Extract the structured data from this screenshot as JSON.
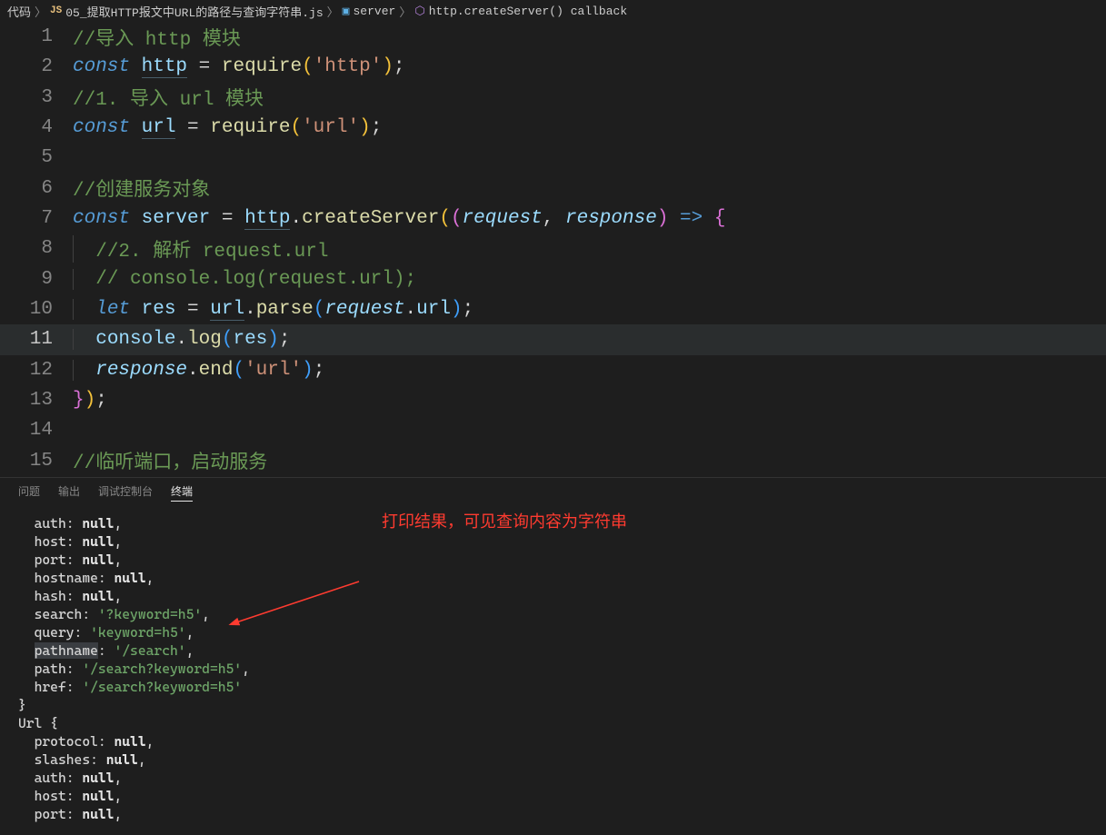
{
  "breadcrumb": {
    "root": "代码",
    "file": "05_提取HTTP报文中URL的路径与查询字符串.js",
    "symbol1": "server",
    "symbol2": "http.createServer() callback"
  },
  "code": {
    "l1_comment": "//导入 http 模块",
    "l2_const": "const",
    "l2_http": "http",
    "l2_eq": " = ",
    "l2_require": "require",
    "l2_lp": "(",
    "l2_str": "'http'",
    "l2_rp": ")",
    "l2_semi": ";",
    "l3_comment": "//1. 导入 url 模块",
    "l4_const": "const",
    "l4_url": "url",
    "l4_eq": " = ",
    "l4_require": "require",
    "l4_lp": "(",
    "l4_str": "'url'",
    "l4_rp": ")",
    "l4_semi": ";",
    "l6_comment": "//创建服务对象",
    "l7_const": "const",
    "l7_server": " server ",
    "l7_eq": "= ",
    "l7_http": "http",
    "l7_dot": ".",
    "l7_create": "createServer",
    "l7_lp1": "(",
    "l7_lp2": "(",
    "l7_req": "request",
    "l7_comma": ", ",
    "l7_resp": "response",
    "l7_rp2": ")",
    "l7_arrow": " => ",
    "l7_brace": "{",
    "l8_comment": "//2. 解析 request.url",
    "l9_comment": "// console.log(request.url);",
    "l10_let": "let",
    "l10_res": " res ",
    "l10_eq": "= ",
    "l10_url": "url",
    "l10_dot": ".",
    "l10_parse": "parse",
    "l10_lp": "(",
    "l10_req": "request",
    "l10_dot2": ".",
    "l10_urlp": "url",
    "l10_rp": ")",
    "l10_semi": ";",
    "l11_console": "console",
    "l11_dot": ".",
    "l11_log": "log",
    "l11_lp": "(",
    "l11_res": "res",
    "l11_rp": ")",
    "l11_semi": ";",
    "l12_resp": "response",
    "l12_dot": ".",
    "l12_end": "end",
    "l12_lp": "(",
    "l12_str": "'url'",
    "l12_rp": ")",
    "l12_semi": ";",
    "l13_brace": "}",
    "l13_rp": ")",
    "l13_semi": ";",
    "l15_comment": "//临听端口，启动服务"
  },
  "line_numbers": [
    "1",
    "2",
    "3",
    "4",
    "5",
    "6",
    "7",
    "8",
    "9",
    "10",
    "11",
    "12",
    "13",
    "14",
    "15"
  ],
  "panel_tabs": {
    "problems": "问题",
    "output": "输出",
    "debug": "调试控制台",
    "terminal": "终端"
  },
  "terminal": {
    "l1": {
      "k": "auth: ",
      "v": "null",
      "c": ","
    },
    "l2": {
      "k": "host: ",
      "v": "null",
      "c": ","
    },
    "l3": {
      "k": "port: ",
      "v": "null",
      "c": ","
    },
    "l4": {
      "k": "hostname: ",
      "v": "null",
      "c": ","
    },
    "l5": {
      "k": "hash: ",
      "v": "null",
      "c": ","
    },
    "l6": {
      "k": "search: ",
      "v": "'?keyword=h5'",
      "c": ","
    },
    "l7": {
      "k": "query: ",
      "v": "'keyword=h5'",
      "c": ","
    },
    "l8": {
      "k": "pathname",
      "k2": ": ",
      "v": "'/search'",
      "c": ","
    },
    "l9": {
      "k": "path: ",
      "v": "'/search?keyword=h5'",
      "c": ","
    },
    "l10": {
      "k": "href: ",
      "v": "'/search?keyword=h5'"
    },
    "l11": "}",
    "l12": "Url {",
    "l13": {
      "k": "protocol: ",
      "v": "null",
      "c": ","
    },
    "l14": {
      "k": "slashes: ",
      "v": "null",
      "c": ","
    },
    "l15": {
      "k": "auth: ",
      "v": "null",
      "c": ","
    },
    "l16": {
      "k": "host: ",
      "v": "null",
      "c": ","
    },
    "l17": {
      "k": "port: ",
      "v": "null",
      "c": ","
    }
  },
  "annotation": "打印结果，可见查询内容为字符串"
}
